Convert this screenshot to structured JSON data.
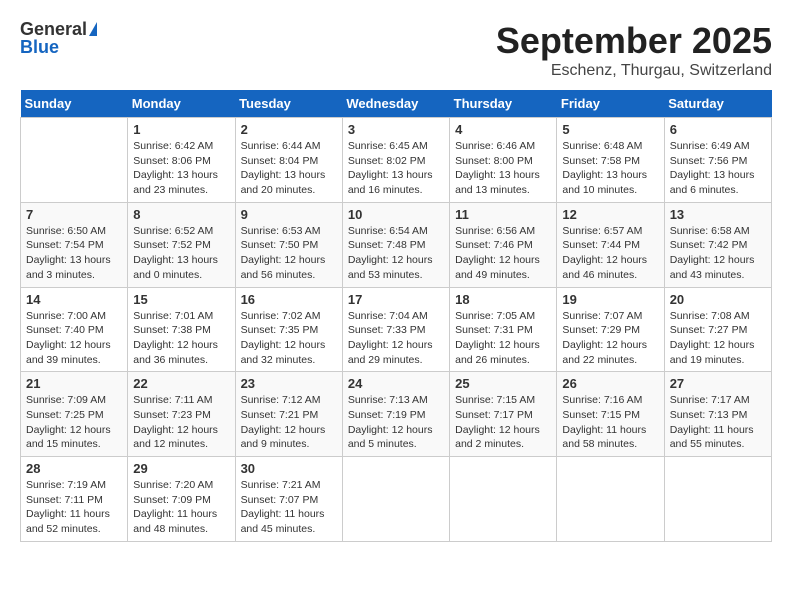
{
  "header": {
    "logo_general": "General",
    "logo_blue": "Blue",
    "month": "September 2025",
    "location": "Eschenz, Thurgau, Switzerland"
  },
  "days_of_week": [
    "Sunday",
    "Monday",
    "Tuesday",
    "Wednesday",
    "Thursday",
    "Friday",
    "Saturday"
  ],
  "weeks": [
    [
      {
        "day": "",
        "content": ""
      },
      {
        "day": "1",
        "content": "Sunrise: 6:42 AM\nSunset: 8:06 PM\nDaylight: 13 hours\nand 23 minutes."
      },
      {
        "day": "2",
        "content": "Sunrise: 6:44 AM\nSunset: 8:04 PM\nDaylight: 13 hours\nand 20 minutes."
      },
      {
        "day": "3",
        "content": "Sunrise: 6:45 AM\nSunset: 8:02 PM\nDaylight: 13 hours\nand 16 minutes."
      },
      {
        "day": "4",
        "content": "Sunrise: 6:46 AM\nSunset: 8:00 PM\nDaylight: 13 hours\nand 13 minutes."
      },
      {
        "day": "5",
        "content": "Sunrise: 6:48 AM\nSunset: 7:58 PM\nDaylight: 13 hours\nand 10 minutes."
      },
      {
        "day": "6",
        "content": "Sunrise: 6:49 AM\nSunset: 7:56 PM\nDaylight: 13 hours\nand 6 minutes."
      }
    ],
    [
      {
        "day": "7",
        "content": "Sunrise: 6:50 AM\nSunset: 7:54 PM\nDaylight: 13 hours\nand 3 minutes."
      },
      {
        "day": "8",
        "content": "Sunrise: 6:52 AM\nSunset: 7:52 PM\nDaylight: 13 hours\nand 0 minutes."
      },
      {
        "day": "9",
        "content": "Sunrise: 6:53 AM\nSunset: 7:50 PM\nDaylight: 12 hours\nand 56 minutes."
      },
      {
        "day": "10",
        "content": "Sunrise: 6:54 AM\nSunset: 7:48 PM\nDaylight: 12 hours\nand 53 minutes."
      },
      {
        "day": "11",
        "content": "Sunrise: 6:56 AM\nSunset: 7:46 PM\nDaylight: 12 hours\nand 49 minutes."
      },
      {
        "day": "12",
        "content": "Sunrise: 6:57 AM\nSunset: 7:44 PM\nDaylight: 12 hours\nand 46 minutes."
      },
      {
        "day": "13",
        "content": "Sunrise: 6:58 AM\nSunset: 7:42 PM\nDaylight: 12 hours\nand 43 minutes."
      }
    ],
    [
      {
        "day": "14",
        "content": "Sunrise: 7:00 AM\nSunset: 7:40 PM\nDaylight: 12 hours\nand 39 minutes."
      },
      {
        "day": "15",
        "content": "Sunrise: 7:01 AM\nSunset: 7:38 PM\nDaylight: 12 hours\nand 36 minutes."
      },
      {
        "day": "16",
        "content": "Sunrise: 7:02 AM\nSunset: 7:35 PM\nDaylight: 12 hours\nand 32 minutes."
      },
      {
        "day": "17",
        "content": "Sunrise: 7:04 AM\nSunset: 7:33 PM\nDaylight: 12 hours\nand 29 minutes."
      },
      {
        "day": "18",
        "content": "Sunrise: 7:05 AM\nSunset: 7:31 PM\nDaylight: 12 hours\nand 26 minutes."
      },
      {
        "day": "19",
        "content": "Sunrise: 7:07 AM\nSunset: 7:29 PM\nDaylight: 12 hours\nand 22 minutes."
      },
      {
        "day": "20",
        "content": "Sunrise: 7:08 AM\nSunset: 7:27 PM\nDaylight: 12 hours\nand 19 minutes."
      }
    ],
    [
      {
        "day": "21",
        "content": "Sunrise: 7:09 AM\nSunset: 7:25 PM\nDaylight: 12 hours\nand 15 minutes."
      },
      {
        "day": "22",
        "content": "Sunrise: 7:11 AM\nSunset: 7:23 PM\nDaylight: 12 hours\nand 12 minutes."
      },
      {
        "day": "23",
        "content": "Sunrise: 7:12 AM\nSunset: 7:21 PM\nDaylight: 12 hours\nand 9 minutes."
      },
      {
        "day": "24",
        "content": "Sunrise: 7:13 AM\nSunset: 7:19 PM\nDaylight: 12 hours\nand 5 minutes."
      },
      {
        "day": "25",
        "content": "Sunrise: 7:15 AM\nSunset: 7:17 PM\nDaylight: 12 hours\nand 2 minutes."
      },
      {
        "day": "26",
        "content": "Sunrise: 7:16 AM\nSunset: 7:15 PM\nDaylight: 11 hours\nand 58 minutes."
      },
      {
        "day": "27",
        "content": "Sunrise: 7:17 AM\nSunset: 7:13 PM\nDaylight: 11 hours\nand 55 minutes."
      }
    ],
    [
      {
        "day": "28",
        "content": "Sunrise: 7:19 AM\nSunset: 7:11 PM\nDaylight: 11 hours\nand 52 minutes."
      },
      {
        "day": "29",
        "content": "Sunrise: 7:20 AM\nSunset: 7:09 PM\nDaylight: 11 hours\nand 48 minutes."
      },
      {
        "day": "30",
        "content": "Sunrise: 7:21 AM\nSunset: 7:07 PM\nDaylight: 11 hours\nand 45 minutes."
      },
      {
        "day": "",
        "content": ""
      },
      {
        "day": "",
        "content": ""
      },
      {
        "day": "",
        "content": ""
      },
      {
        "day": "",
        "content": ""
      }
    ]
  ]
}
